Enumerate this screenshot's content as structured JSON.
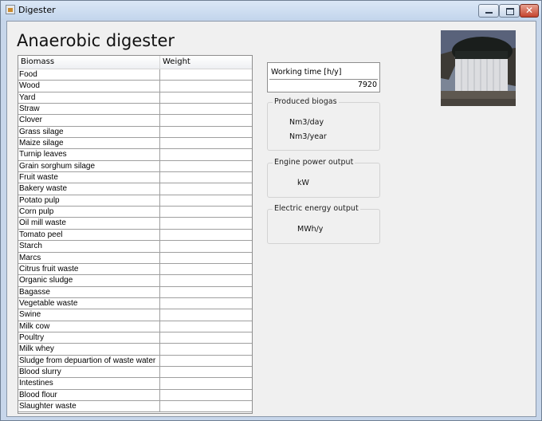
{
  "window": {
    "title": "Digester"
  },
  "heading": "Anaerobic digester",
  "table": {
    "columns": [
      "Biomass",
      "Weight"
    ],
    "rows": [
      "Food",
      "Wood",
      "Yard",
      "Straw",
      "Clover",
      "Grass silage",
      "Maize silage",
      "Turnip leaves",
      "Grain sorghum silage",
      "Fruit waste",
      "Bakery waste",
      "Potato pulp",
      "Corn pulp",
      "Oil mill waste",
      "Tomato peel",
      "Starch",
      "Marcs",
      "Citrus fruit waste",
      "Organic sludge",
      "Bagasse",
      "Vegetable waste",
      "Swine",
      "Milk cow",
      "Poultry",
      "Milk whey",
      "Sludge from depuartion of waste water",
      "Blood slurry",
      "Intestines",
      "Blood flour",
      "Slaughter waste"
    ]
  },
  "working_time": {
    "label": "Working time [h/y]",
    "value": "7920"
  },
  "biogas": {
    "title": "Produced biogas",
    "unit_day": "Nm3/day",
    "unit_year": "Nm3/year"
  },
  "engine": {
    "title": "Engine power output",
    "unit": "kW"
  },
  "electric": {
    "title": "Electric energy output",
    "unit": "MWh/y"
  }
}
